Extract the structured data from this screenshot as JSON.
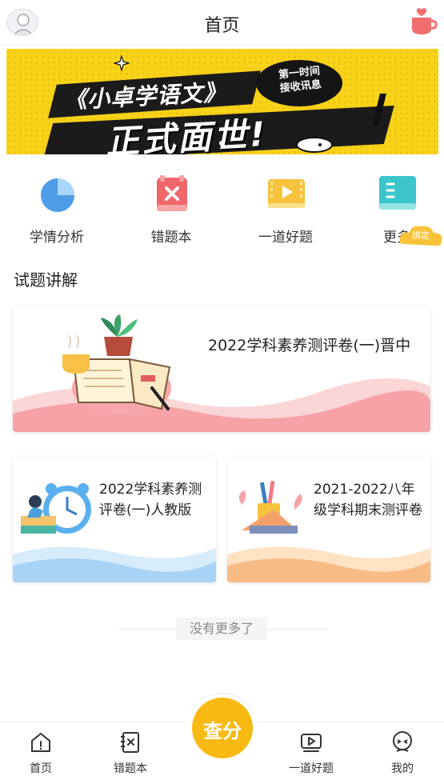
{
  "header": {
    "title": "首页"
  },
  "banner": {
    "line1": "《小卓学语文》",
    "line2": "正式面世!",
    "bubble": "第一时间\n接收讯息"
  },
  "quick_nav": [
    {
      "label": "学情分析",
      "icon": "pie-chart-icon"
    },
    {
      "label": "错题本",
      "icon": "wrong-book-icon"
    },
    {
      "label": "一道好题",
      "icon": "video-icon"
    },
    {
      "label": "更多",
      "icon": "book-icon"
    }
  ],
  "bind_badge": "绑定",
  "section": {
    "title": "试题讲解"
  },
  "papers": [
    {
      "title": "2022学科素养测评卷(一)晋中"
    },
    {
      "title": "2022学科素养测评卷(一)人教版"
    },
    {
      "title": "2021-2022八年级学科期末测评卷"
    }
  ],
  "no_more": "没有更多了",
  "tabbar": {
    "tabs": [
      {
        "label": "首页",
        "icon": "home-icon"
      },
      {
        "label": "错题本",
        "icon": "wrong-book-icon"
      },
      {
        "label": "一道好题",
        "icon": "video-icon"
      },
      {
        "label": "我的",
        "icon": "profile-icon"
      }
    ],
    "center": "查分"
  },
  "colors": {
    "accent": "#f8b912",
    "banner_yellow": "#f9d21a",
    "pink": "#f27b85",
    "blue": "#5aa5ec",
    "cyan": "#3cc6cb"
  }
}
